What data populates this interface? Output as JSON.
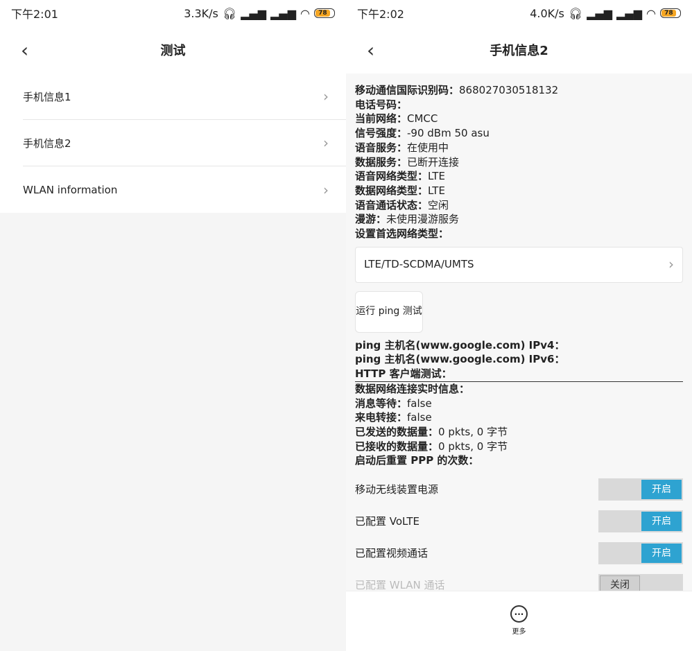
{
  "left": {
    "status": {
      "time": "下午2:01",
      "speed": "3.3K/s",
      "battery": "78"
    },
    "title": "测试",
    "items": [
      "手机信息1",
      "手机信息2",
      "WLAN information"
    ]
  },
  "right": {
    "status": {
      "time": "下午2:02",
      "speed": "4.0K/s",
      "battery": "78"
    },
    "title": "手机信息2",
    "info": [
      {
        "label": "移动通信国际识别码：",
        "value": "868027030518132"
      },
      {
        "label": "电话号码：",
        "value": ""
      },
      {
        "label": "当前网络：",
        "value": "CMCC"
      },
      {
        "label": "信号强度：",
        "value": "-90 dBm   50 asu"
      },
      {
        "label": "语音服务：",
        "value": "在使用中"
      },
      {
        "label": "数据服务：",
        "value": "已断开连接"
      },
      {
        "label": "语音网络类型：",
        "value": "LTE"
      },
      {
        "label": "数据网络类型：",
        "value": "LTE"
      },
      {
        "label": "语音通话状态：",
        "value": "空闲"
      },
      {
        "label": "漫游：",
        "value": "未使用漫游服务"
      },
      {
        "label": "设置首选网络类型：",
        "value": ""
      }
    ],
    "network_type": "LTE/TD-SCDMA/UMTS",
    "ping_button": "运行 ping 测试",
    "ping": [
      {
        "label": "ping 主机名(www.google.com) IPv4：",
        "value": ""
      },
      {
        "label": "ping 主机名(www.google.com) IPv6：",
        "value": ""
      },
      {
        "label": "HTTP 客户端测试：",
        "value": ""
      }
    ],
    "info2": [
      {
        "label": "数据网络连接实时信息：",
        "value": ""
      },
      {
        "label": "消息等待：",
        "value": "false"
      },
      {
        "label": "来电转接：",
        "value": "false"
      },
      {
        "label": "已发送的数据量：",
        "value": "0 pkts, 0 字节"
      },
      {
        "label": "已接收的数据量：",
        "value": "0 pkts, 0 字节"
      },
      {
        "label": "启动后重置 PPP 的次数：",
        "value": ""
      }
    ],
    "toggles": [
      {
        "label": "移动无线装置电源",
        "state": "开启",
        "on": true
      },
      {
        "label": "已配置 VoLTE",
        "state": "开启",
        "on": true
      },
      {
        "label": "已配置视频通话",
        "state": "开启",
        "on": true
      },
      {
        "label": "已配置 WLAN 通话",
        "state": "关闭",
        "on": false
      }
    ],
    "more": "更多"
  },
  "colors": {
    "accent": "#2ea3d1",
    "battery": "#f5a623"
  }
}
